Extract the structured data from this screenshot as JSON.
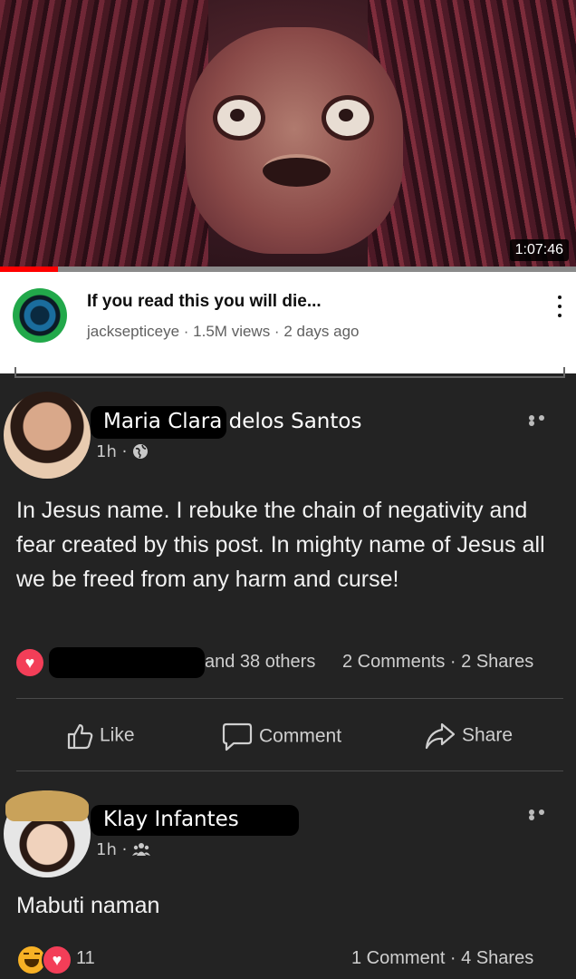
{
  "video": {
    "duration": "1:07:46",
    "progress_fraction": 0.1,
    "title": "If you read this you will die...",
    "channel": "jacksepticeye",
    "views": "1.5M views",
    "age": "2 days ago"
  },
  "post1": {
    "author": "Maria Clara delos Santos",
    "time": "1h",
    "audience_icon": "globe-icon",
    "text": "In Jesus name. I rebuke the chain of negativity and fear created by this post. In mighty name of Jesus all we be freed from any harm and curse!",
    "reactions_text": "and 38 others",
    "comments": "2 Comments",
    "shares": "2 Shares"
  },
  "actions": {
    "like": "Like",
    "comment": "Comment",
    "share": "Share"
  },
  "post2": {
    "author": "Klay Infantes",
    "time": "1h",
    "audience_icon": "friends-icon",
    "text": "Mabuti naman",
    "reaction_count": "11",
    "comments": "1 Comment",
    "shares": "4 Shares"
  },
  "colors": {
    "background": "#232323",
    "love": "#f33e58",
    "haha": "#f7b125",
    "yt_red": "#ff0000"
  }
}
